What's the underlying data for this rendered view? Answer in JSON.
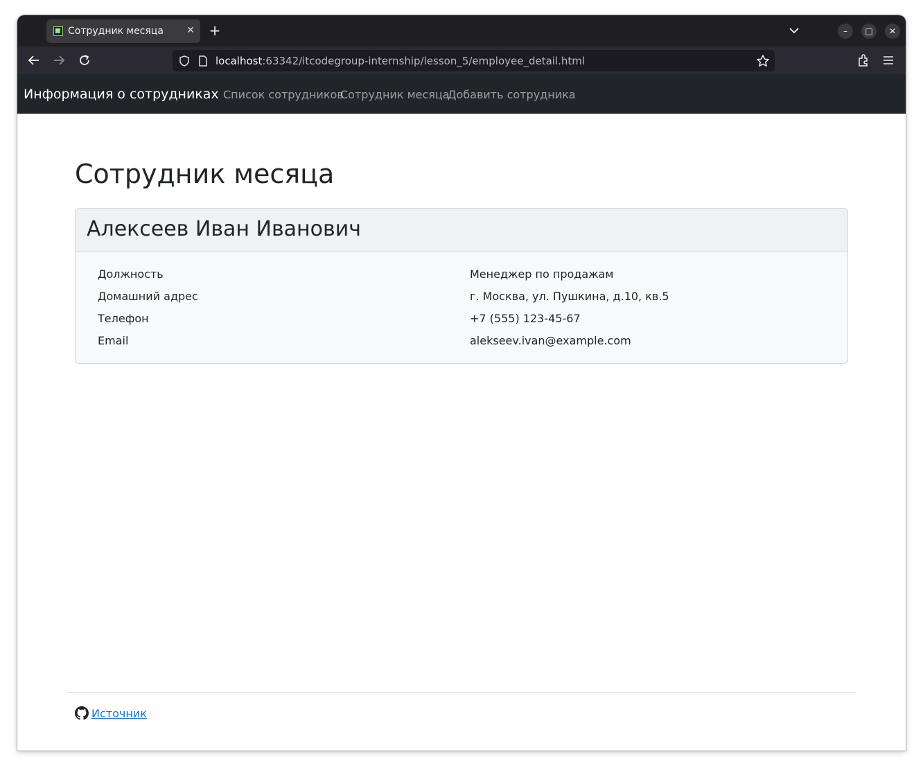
{
  "browser": {
    "tab": {
      "title": "Сотрудник месяца",
      "close_glyph": "✕"
    },
    "new_tab_glyph": "+",
    "window_controls": {
      "minimize": "–",
      "maximize": "□",
      "close": "✕"
    },
    "address": {
      "host": "localhost",
      "rest": ":63342/itcodegroup-internship/lesson_5/employee_detail.html"
    },
    "icons": [
      "back-arrow-icon",
      "forward-arrow-icon",
      "reload-icon",
      "shield-icon",
      "page-icon",
      "bookmark-star-icon",
      "extensions-icon",
      "menu-icon"
    ]
  },
  "navbar": {
    "brand": "Информация о сотрудниках",
    "links": [
      "Список сотрудников",
      "Сотрудник месяца",
      "Добавить сотрудника"
    ]
  },
  "main": {
    "title": "Сотрудник месяца",
    "card": {
      "name": "Алексеев Иван Иванович",
      "rows": [
        {
          "label": "Должность",
          "value": "Менеджер по продажам"
        },
        {
          "label": "Домашний адрес",
          "value": "г. Москва, ул. Пушкина, д.10, кв.5"
        },
        {
          "label": "Телефон",
          "value": "+7 (555) 123-45-67"
        },
        {
          "label": "Email",
          "value": "alekseev.ivan@example.com"
        }
      ]
    }
  },
  "footer": {
    "link_text": "Источник",
    "icon": "github-icon"
  },
  "colors": {
    "navbar_bg": "#212529",
    "link": "#0d6efd",
    "text": "#212529"
  }
}
